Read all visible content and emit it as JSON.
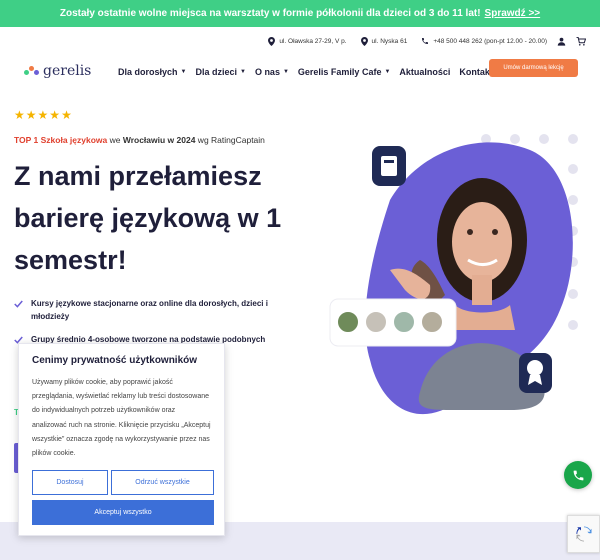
{
  "promo": {
    "text": "Zostały ostatnie wolne miejsca na warsztaty w formie półkolonii dla dzieci od 3 do 11 lat!",
    "link": "Sprawdź >>"
  },
  "contact": {
    "address1": "ul. Oławska 27-29, V p.",
    "address2": "ul. Nyska 61",
    "phone": "+48 500 448 262 (pon-pt 12.00 - 20.00)"
  },
  "logo": {
    "text": "gerelis"
  },
  "nav": {
    "items": [
      {
        "label": "Dla dorosłych",
        "has_menu": true
      },
      {
        "label": "Dla dzieci",
        "has_menu": true
      },
      {
        "label": "O nas",
        "has_menu": true
      },
      {
        "label": "Gerelis Family Cafe",
        "has_menu": true
      },
      {
        "label": "Aktualności",
        "has_menu": false
      },
      {
        "label": "Kontakt",
        "has_menu": false
      }
    ],
    "cta": "Umów darmową lekcję"
  },
  "hero": {
    "stars": 5,
    "rating": {
      "highlight": "TOP 1 Szkoła językowa",
      "mid": " we ",
      "bold": "Wrocławiu w 2024",
      "tail": " wg RatingCaptain"
    },
    "headline": "Z nami przełamiesz barierę językową w 1 semestr!",
    "bullets": [
      "Kursy językowe stacjonarne oraz online dla dorosłych, dzieci i młodzieży",
      "Grupy średnio 4-osobowe tworzone na podstawie podobnych"
    ]
  },
  "cookie": {
    "title": "Cenimy prywatność użytkowników",
    "body": "Używamy plików cookie, aby poprawić jakość przeglądania, wyświetlać reklamy lub treści dostosowane do indywidualnych potrzeb użytkowników oraz analizować ruch na stronie. Kliknięcie przycisku „Akceptuj wszystkie” oznacza zgodę na wykorzystywanie przez nas plików cookie.",
    "customize": "Dostosuj",
    "reject": "Odrzuć wszystkie",
    "accept": "Akceptuj wszystko"
  },
  "colors": {
    "promo_bg": "#3fcf86",
    "cta_orange": "#f07b45",
    "brand_navy": "#1f1f3a",
    "purple_blob": "#6b5fd6",
    "cookie_blue": "#3c6fd8",
    "phone_green": "#19a64a",
    "star_gold": "#f5b400"
  }
}
